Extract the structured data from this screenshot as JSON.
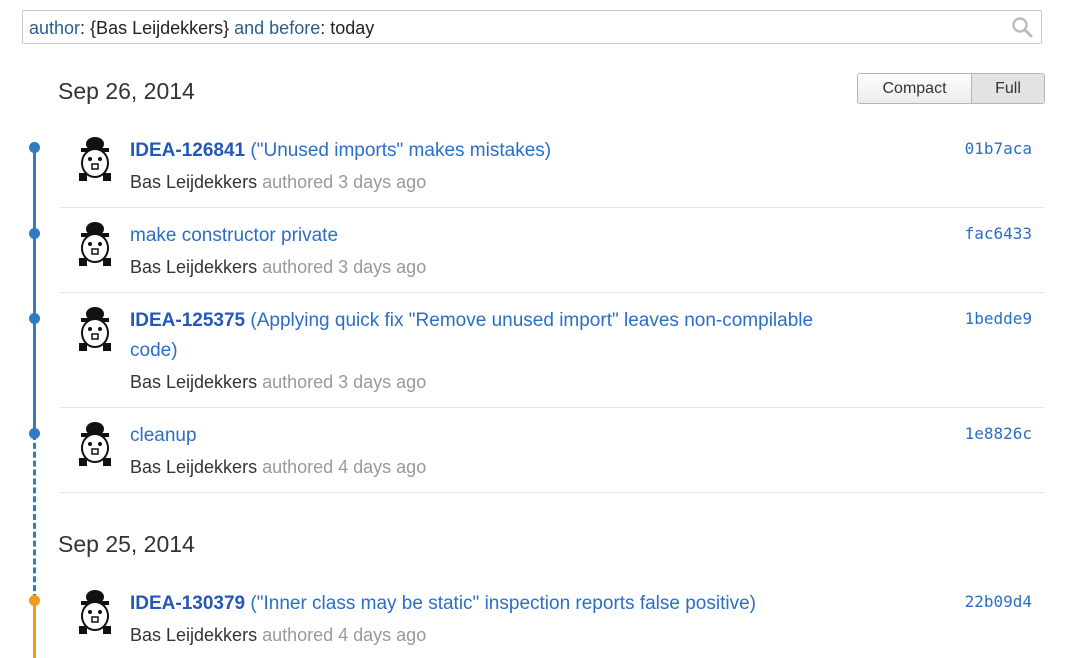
{
  "search": {
    "tokens": [
      {
        "text": "author",
        "kind": "kw"
      },
      {
        "text": ": {Bas Leijdekkers} ",
        "kind": "val"
      },
      {
        "text": "and before",
        "kind": "kw"
      },
      {
        "text": ": today",
        "kind": "val"
      }
    ],
    "icon": "search-icon"
  },
  "view_toggle": {
    "compact_label": "Compact",
    "full_label": "Full",
    "selected": "Full"
  },
  "groups": [
    {
      "date": "Sep 26, 2014",
      "commits": [
        {
          "issue": "IDEA-126841",
          "message": " (\"Unused imports\" makes mistakes)",
          "author": "Bas Leijdekkers",
          "authored_label": " authored ",
          "ago": "3 days ago",
          "hash": "01b7aca"
        },
        {
          "issue": "",
          "message": "make constructor private",
          "author": "Bas Leijdekkers",
          "authored_label": " authored ",
          "ago": "3 days ago",
          "hash": "fac6433"
        },
        {
          "issue": "IDEA-125375",
          "message": " (Applying quick fix \"Remove unused import\" leaves non-compilable code)",
          "author": "Bas Leijdekkers",
          "authored_label": " authored ",
          "ago": "3 days ago",
          "hash": "1bedde9"
        },
        {
          "issue": "",
          "message": "cleanup",
          "author": "Bas Leijdekkers",
          "authored_label": " authored ",
          "ago": "4 days ago",
          "hash": "1e8826c"
        }
      ]
    },
    {
      "date": "Sep 25, 2014",
      "commits": [
        {
          "issue": "IDEA-130379",
          "message": " (\"Inner class may be static\" inspection reports false positive)",
          "author": "Bas Leijdekkers",
          "authored_label": " authored ",
          "ago": "4 days ago",
          "hash": "22b09d4"
        }
      ]
    }
  ],
  "colors": {
    "accent": "#2f7bbf",
    "link": "#2a6ec6",
    "branch_orange": "#f39b1f"
  }
}
